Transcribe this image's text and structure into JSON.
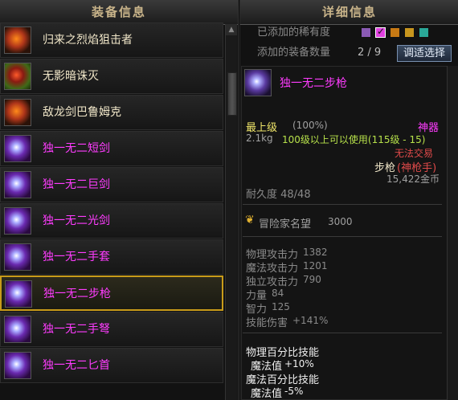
{
  "left_panel": {
    "title": "装备信息",
    "items": [
      {
        "label": "归来之烈焰狙击者",
        "icon": "flame-sniper-icon",
        "style": "ow"
      },
      {
        "label": "无影暗诛灭",
        "icon": "shadow-weapon-icon",
        "style": "ow"
      },
      {
        "label": "敌龙剑巴鲁姆克",
        "icon": "dragon-sword-icon",
        "style": "ow"
      },
      {
        "label": "独一无二短剑",
        "icon": "short-sword-icon",
        "style": "pu"
      },
      {
        "label": "独一无二巨剑",
        "icon": "great-sword-icon",
        "style": "pu"
      },
      {
        "label": "独一无二光剑",
        "icon": "light-sword-icon",
        "style": "pu"
      },
      {
        "label": "独一无二手套",
        "icon": "gauntlet-icon",
        "style": "pu"
      },
      {
        "label": "独一无二步枪",
        "icon": "rifle-icon",
        "style": "pu",
        "selected": true
      },
      {
        "label": "独一无二手弩",
        "icon": "crossbow-icon",
        "style": "pu"
      },
      {
        "label": "独一无二匕首",
        "icon": "dagger-icon",
        "style": "pu"
      }
    ]
  },
  "right_panel": {
    "title": "详细信息",
    "rarity_label": "已添加的稀有度",
    "count_label": "添加的装备数量",
    "count_value": "2 / 9",
    "adjust_button": "调适选择",
    "rarity_colors": [
      "#8a5ab4",
      "#e040e0",
      "#c87a14",
      "#c8961e",
      "#2aa898"
    ]
  },
  "detail": {
    "name": "独一无二步枪",
    "grade": "最上级",
    "grade_pct": "(100%)",
    "rarity": "神器",
    "weight": "2.1kg",
    "level_req": "100级以上可以使用(115级 - 15)",
    "untradeable": "无法交易",
    "type_main": "步枪",
    "type_sub": "(神枪手)",
    "price": "15,422金币",
    "durability": "耐久度 48/48",
    "renown_label": "冒险家名望",
    "renown_value": "3000",
    "stats": [
      {
        "label": "物理攻击力",
        "value": "1382"
      },
      {
        "label": "魔法攻击力",
        "value": "1201"
      },
      {
        "label": "独立攻击力",
        "value": "790"
      },
      {
        "label": "力量",
        "value": "84"
      },
      {
        "label": "智力",
        "value": "125"
      },
      {
        "label": "技能伤害",
        "value": "+141%"
      }
    ],
    "skills": [
      {
        "title": "物理百分比技能",
        "sub_label": "魔法值",
        "sub_value": "+10%"
      },
      {
        "title": "魔法百分比技能",
        "sub_label": "魔法值",
        "sub_value": "-5%"
      }
    ]
  }
}
